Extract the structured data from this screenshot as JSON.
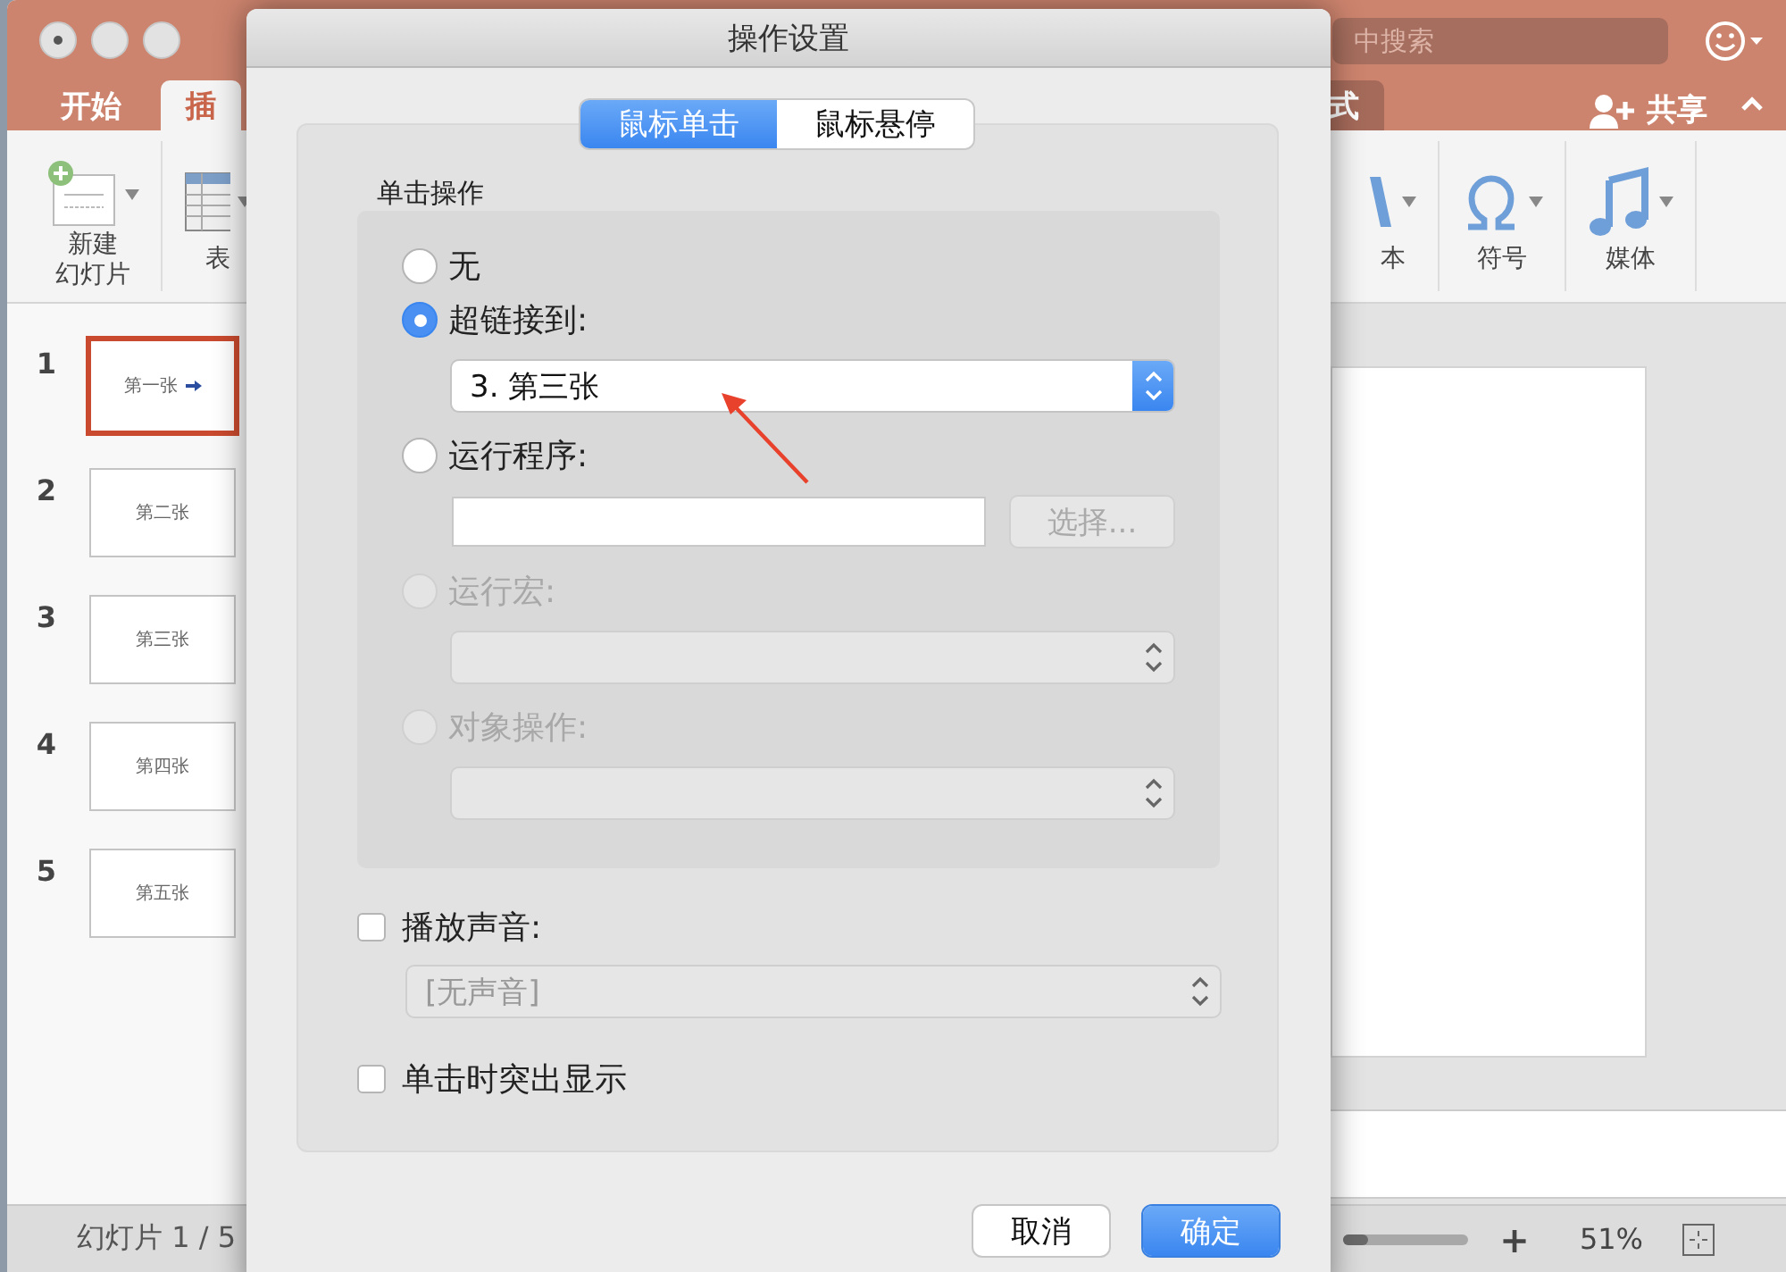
{
  "app": {
    "search": {
      "placeholder": "中搜索"
    },
    "left_tabs": [
      {
        "label": "开始",
        "selected": false
      },
      {
        "label": "插",
        "selected": true
      }
    ],
    "right_tabs": [
      {
        "label": "式",
        "selected": false
      }
    ],
    "share": {
      "label": "共享"
    },
    "ribbon": {
      "left_groups": [
        {
          "kind": "slide",
          "lines": [
            "新建",
            "幻灯片"
          ]
        },
        {
          "kind": "table",
          "lines": [
            "表"
          ]
        }
      ],
      "right_groups": [
        {
          "kind": "text",
          "lines": [
            "本"
          ]
        },
        {
          "kind": "symbol",
          "lines": [
            "符号"
          ]
        },
        {
          "kind": "media",
          "lines": [
            "媒体"
          ]
        }
      ]
    },
    "slides": [
      {
        "number": "1",
        "text": "第一张",
        "selected": true,
        "arrow": true
      },
      {
        "number": "2",
        "text": "第二张",
        "selected": false,
        "arrow": false
      },
      {
        "number": "3",
        "text": "第三张",
        "selected": false,
        "arrow": false
      },
      {
        "number": "4",
        "text": "第四张",
        "selected": false,
        "arrow": false
      },
      {
        "number": "5",
        "text": "第五张",
        "selected": false,
        "arrow": false
      }
    ],
    "status": {
      "slide_count": "幻灯片 1 / 5",
      "zoom_slider": {
        "level": 0.2
      },
      "zoom_in": "+",
      "zoom": "51%"
    }
  },
  "dialog": {
    "title": "操作设置",
    "segments": [
      {
        "label": "鼠标单击",
        "selected": true
      },
      {
        "label": "鼠标悬停",
        "selected": false
      }
    ],
    "section_label": "单击操作",
    "options": [
      {
        "label": "无",
        "selected": false,
        "disabled": false
      },
      {
        "label": "超链接到:",
        "selected": true,
        "disabled": false,
        "control": {
          "kind": "select",
          "value": "3. 第三张",
          "disabled": false
        }
      },
      {
        "label": "运行程序:",
        "selected": false,
        "disabled": false,
        "control": {
          "kind": "file",
          "button": "选择...",
          "disabled": true
        }
      },
      {
        "label": "运行宏:",
        "selected": false,
        "disabled": true,
        "control": {
          "kind": "select",
          "disabled": true
        }
      },
      {
        "label": "对象操作:",
        "selected": false,
        "disabled": true,
        "control": {
          "kind": "select",
          "disabled": true
        }
      }
    ],
    "sound": {
      "label": "播放声音:",
      "checked": false,
      "select": {
        "value": "[无声音]",
        "disabled": true
      }
    },
    "highlight": {
      "label": "单击时突出显示",
      "checked": false
    },
    "buttons": [
      {
        "label": "取消",
        "kind": "default"
      },
      {
        "label": "确定",
        "kind": "primary"
      }
    ]
  }
}
